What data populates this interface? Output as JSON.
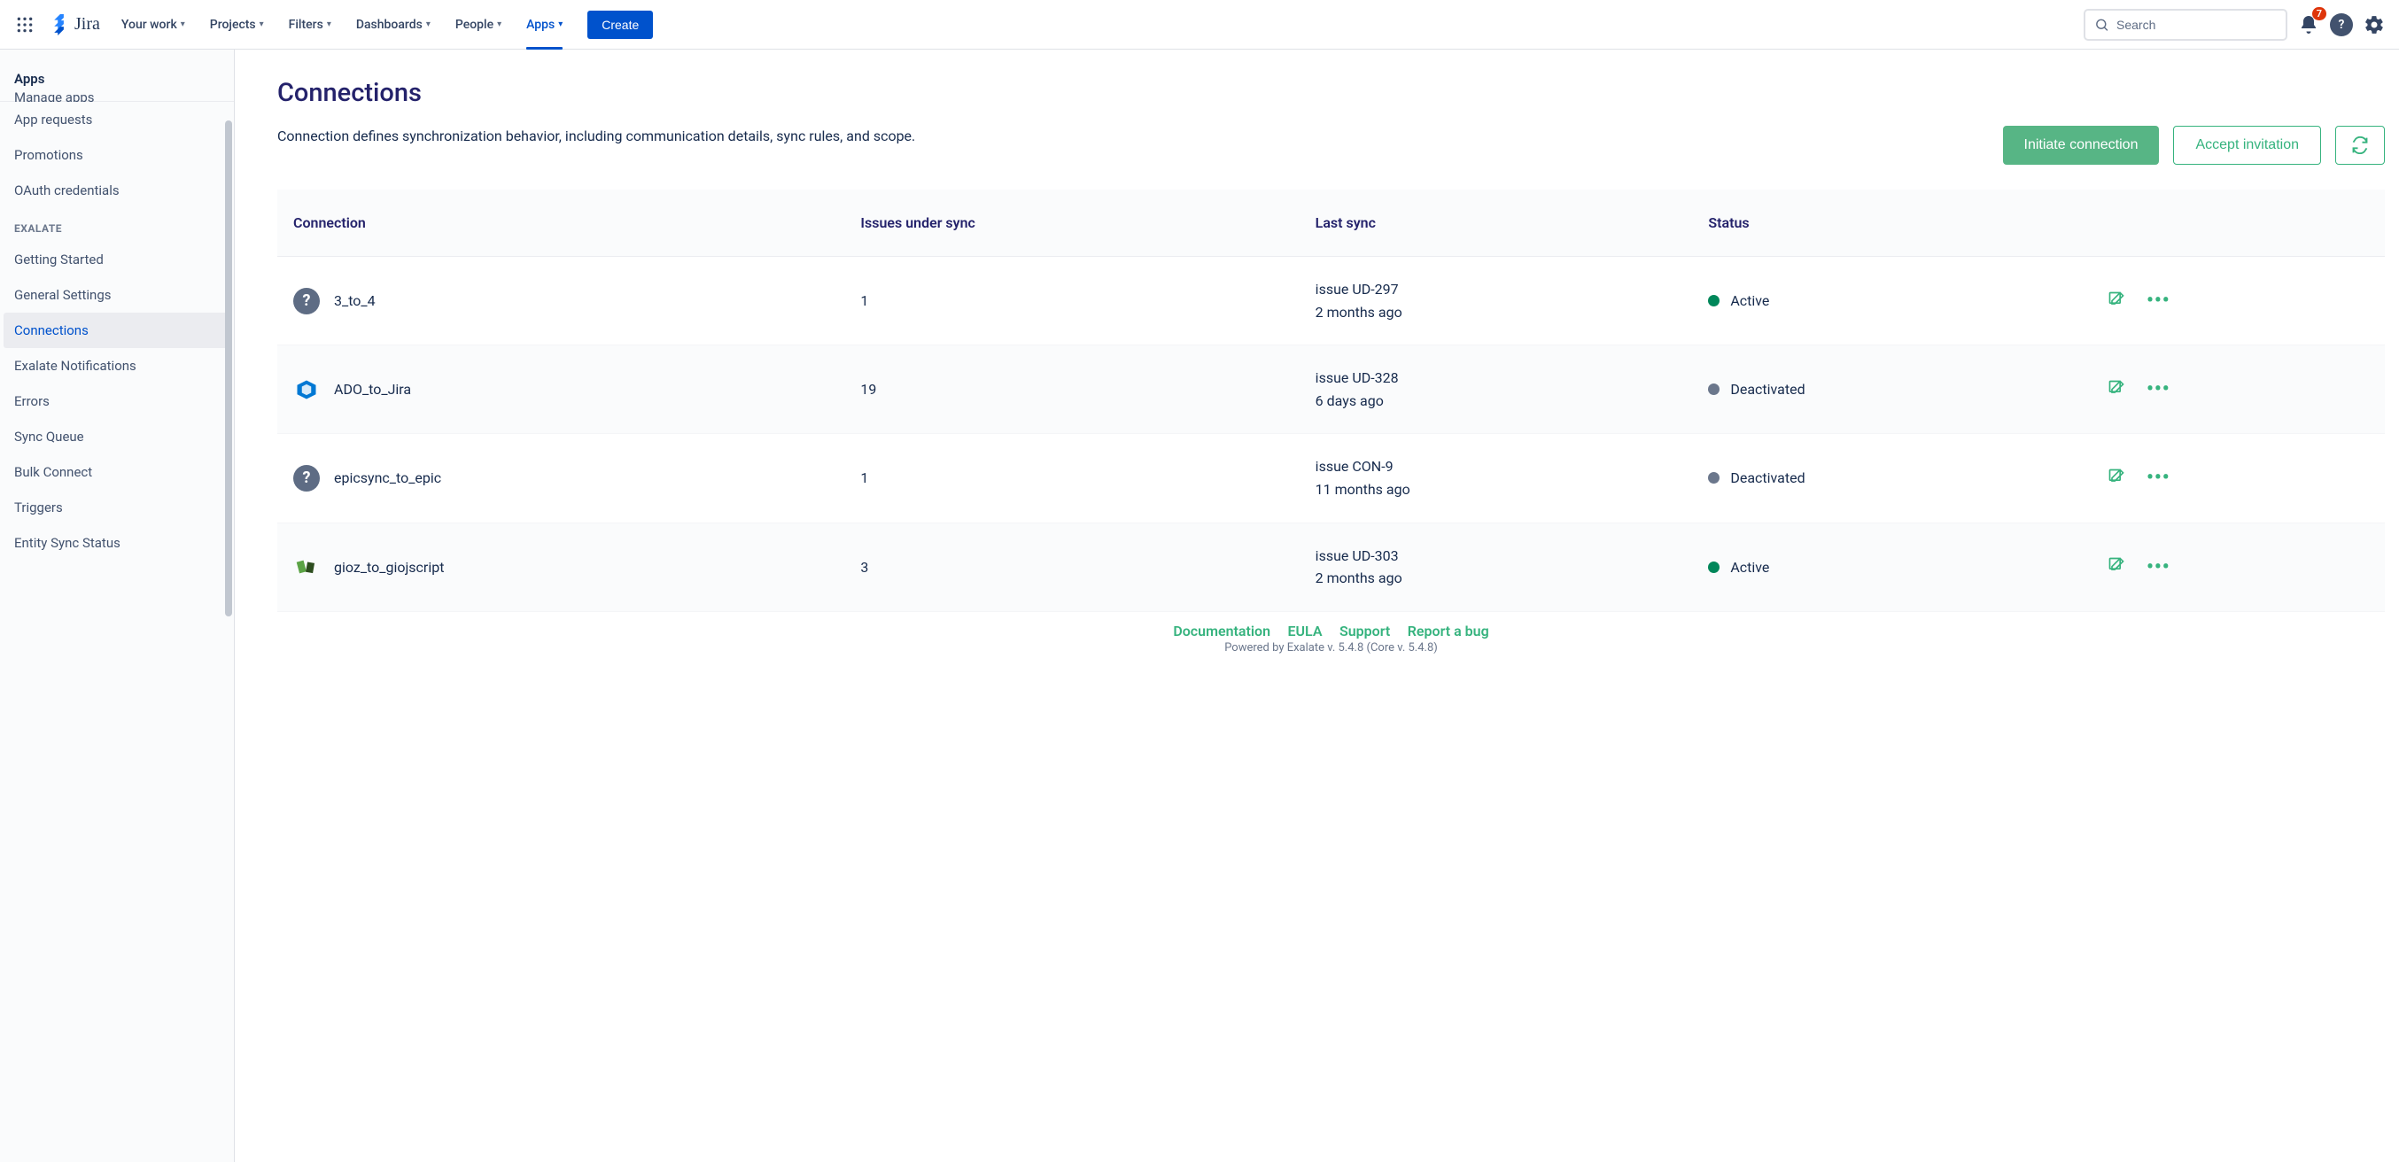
{
  "topbar": {
    "logo_text": "Jira",
    "nav": {
      "your_work": "Your work",
      "projects": "Projects",
      "filters": "Filters",
      "dashboards": "Dashboards",
      "people": "People",
      "apps": "Apps"
    },
    "create": "Create",
    "search_placeholder": "Search",
    "notification_count": "7"
  },
  "sidebar": {
    "header": "Apps",
    "items": {
      "manage_apps": "Manage apps",
      "app_requests": "App requests",
      "promotions": "Promotions",
      "oauth": "OAuth credentials"
    },
    "section": "EXALATE",
    "exalate": {
      "getting_started": "Getting Started",
      "general_settings": "General Settings",
      "connections": "Connections",
      "notifications": "Exalate Notifications",
      "errors": "Errors",
      "sync_queue": "Sync Queue",
      "bulk_connect": "Bulk Connect",
      "triggers": "Triggers",
      "entity_sync": "Entity Sync Status"
    }
  },
  "page": {
    "title": "Connections",
    "description": "Connection defines synchronization behavior, including communication details, sync rules, and scope.",
    "initiate": "Initiate connection",
    "accept": "Accept invitation"
  },
  "table": {
    "headers": {
      "connection": "Connection",
      "issues": "Issues under sync",
      "last_sync": "Last sync",
      "status": "Status"
    },
    "rows": [
      {
        "name": "3_to_4",
        "icon_type": "question",
        "issues": "1",
        "last_issue": "issue UD-297",
        "last_time": "2 months ago",
        "status": "Active",
        "status_class": "active"
      },
      {
        "name": "ADO_to_Jira",
        "icon_type": "ado",
        "issues": "19",
        "last_issue": "issue UD-328",
        "last_time": "6 days ago",
        "status": "Deactivated",
        "status_class": "deactivated"
      },
      {
        "name": "epicsync_to_epic",
        "icon_type": "question",
        "issues": "1",
        "last_issue": "issue CON-9",
        "last_time": "11 months ago",
        "status": "Deactivated",
        "status_class": "deactivated"
      },
      {
        "name": "gioz_to_giojscript",
        "icon_type": "gioz",
        "issues": "3",
        "last_issue": "issue UD-303",
        "last_time": "2 months ago",
        "status": "Active",
        "status_class": "active"
      }
    ]
  },
  "footer": {
    "documentation": "Documentation",
    "eula": "EULA",
    "support": "Support",
    "report": "Report a bug",
    "version": "Powered by Exalate v. 5.4.8 (Core v. 5.4.8)"
  }
}
